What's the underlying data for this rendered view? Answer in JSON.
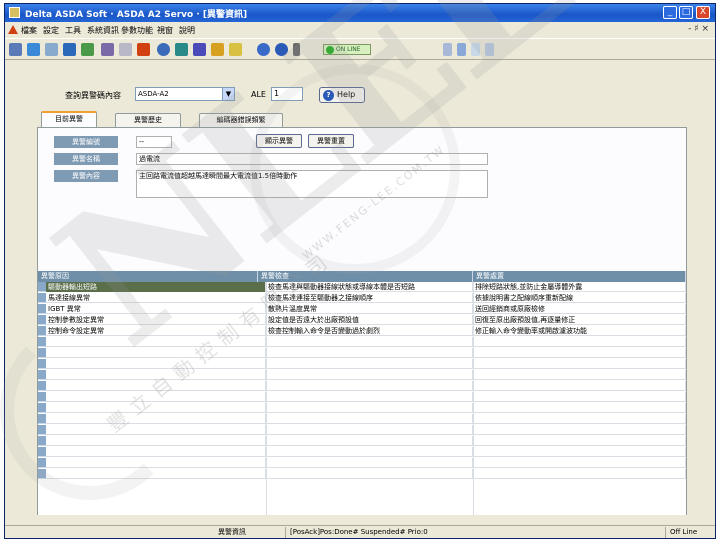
{
  "window": {
    "title": "Delta ASDA Soft · ASDA A2 Servo · [異警資訊]",
    "minimize": "_",
    "maximize": "□",
    "close": "X"
  },
  "menu": {
    "items": [
      "檔案",
      "設定",
      "工具",
      "系統資訊",
      "參數功能",
      "視窗",
      "說明"
    ],
    "right_controls": "- ♯ ×"
  },
  "toolbar": {
    "status_text": "ON LINE",
    "colors": {
      "ok": "#20b020"
    }
  },
  "filter": {
    "label": "查詢異警碼內容",
    "model_value": "ASDA-A2",
    "al_label": "ALE",
    "al_value": "1",
    "help_label": "Help"
  },
  "tabs": [
    {
      "label": "目前異警"
    },
    {
      "label": "異警歷史"
    },
    {
      "label": "編碼器錯誤頻繁"
    }
  ],
  "detail": {
    "code_label": "異警編號",
    "code_value": "--",
    "name_label": "異警名稱",
    "name_value": "過電流",
    "content_label": "異警內容",
    "content_value": "主回路電流值超越馬達瞬間最大電流值1.5倍時動作",
    "reset_button": "顯示異警",
    "clear_button": "異警重置"
  },
  "grid": {
    "headers": [
      "異警原因",
      "異警檢查",
      "異警處置"
    ],
    "rows": [
      [
        "驅動器輸出短路",
        "檢查馬達與驅動器接線狀態或導線本體是否短路",
        "排除短路狀態,並防止金屬導體外露"
      ],
      [
        "馬達接線異常",
        "檢查馬達連接至驅動器之接線順序",
        "依據說明書之配線順序重新配線"
      ],
      [
        "IGBT 異常",
        "散熱片溫度異常",
        "送回經銷商或原廠檢修"
      ],
      [
        "控制參數設定異常",
        "設定值是否遠大於出廠預設值",
        "回復至原出廠預設值,再逐量修正"
      ],
      [
        "控制命令設定異常",
        "檢查控制輸入命令是否變動過於劇烈",
        "修正輸入命令變動率或開啟濾波功能"
      ]
    ],
    "empty_rows": 13
  },
  "status": {
    "center": "異警資訊",
    "message": "[PosAck]Pos:Done# Suspended# Prio:0",
    "right": "Off Line"
  },
  "watermark": {
    "brand": "NLEE",
    "chinese": "豐立自動控制有限公司",
    "url": "WWW.FENG-LEE.COM.TW"
  }
}
